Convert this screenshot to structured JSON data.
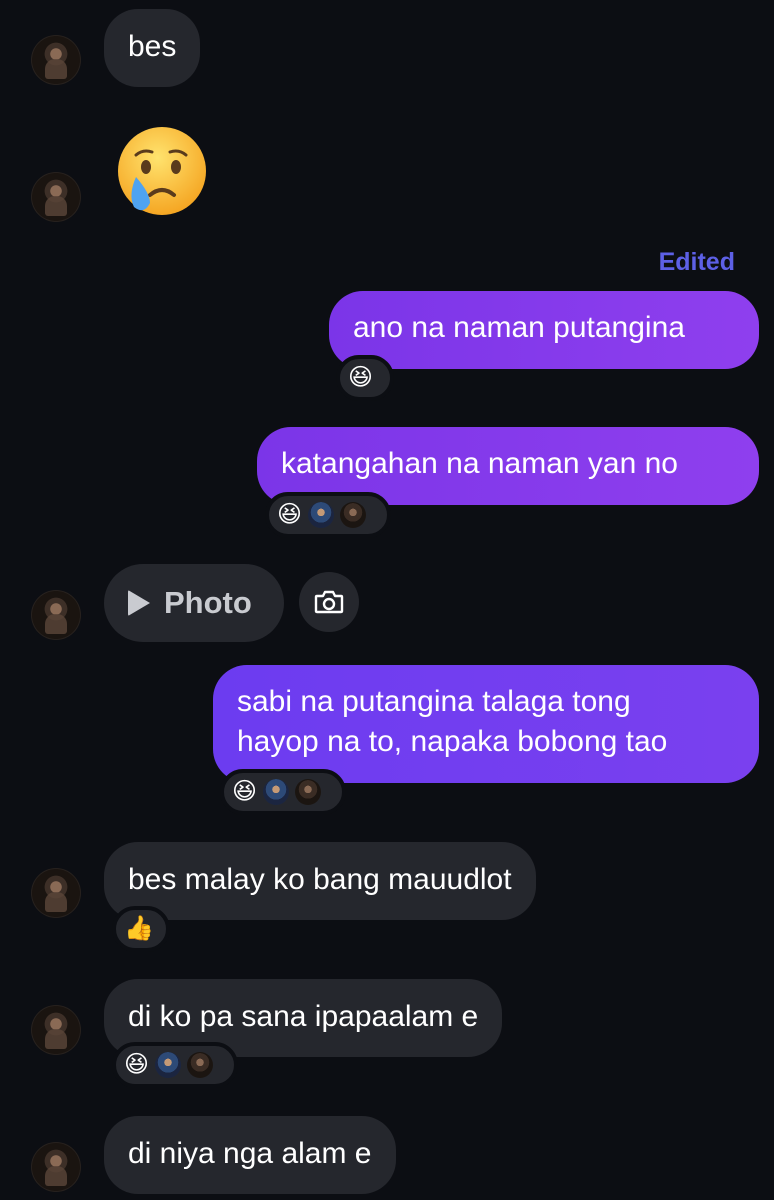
{
  "messages": {
    "m1": {
      "text": "bes"
    },
    "m2": {
      "emoji": "crying-face"
    },
    "m3": {
      "edited_label": "Edited",
      "text": "ano na naman putangina",
      "reaction": "😆"
    },
    "m4": {
      "text": "katangahan na naman yan no",
      "reaction": "😆"
    },
    "m5": {
      "photo_label": "Photo"
    },
    "m6": {
      "line1": "sabi na putangina talaga tong",
      "line2": "hayop na to, napaka bobong tao",
      "reaction": "😆"
    },
    "m7": {
      "text": "bes malay ko bang mauudlot",
      "reaction": "👍"
    },
    "m8": {
      "text": "di ko pa sana ipapaalam e",
      "reaction": "😆"
    },
    "m9": {
      "text": "di niya nga alam e"
    }
  },
  "colors": {
    "background": "#0c0e13",
    "incoming_bubble": "#25272d",
    "outgoing_bubble": "#7b35e8",
    "edited_label": "#5d60e6"
  }
}
